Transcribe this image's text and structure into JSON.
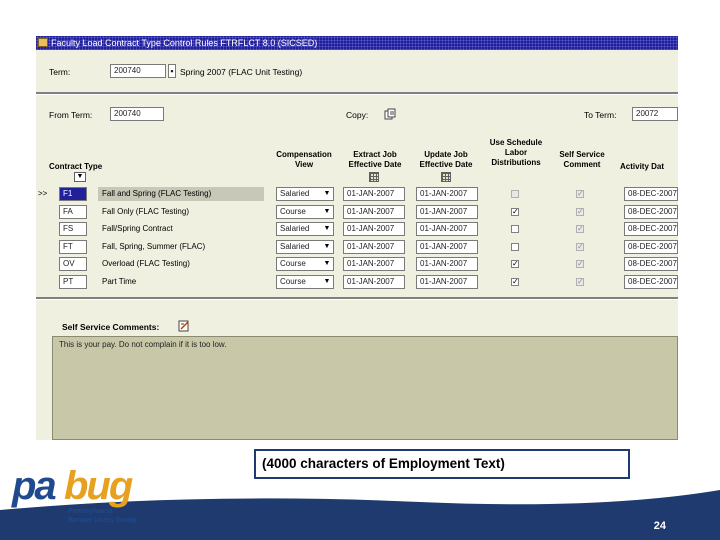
{
  "window": {
    "title": "Faculty Load Contract Type Control Rules  FTRFLCT  8.0  (SICSED)"
  },
  "header": {
    "term_label": "Term:",
    "term_value": "200740",
    "term_desc": "Spring 2007 (FLAC Unit Testing)"
  },
  "copy_section": {
    "from_label": "From Term:",
    "from_value": "200740",
    "copy_label": "Copy:",
    "to_label": "To Term:",
    "to_value": "20072"
  },
  "grid": {
    "headers": {
      "contract_type": "Contract Type",
      "compensation": "Compensation View",
      "extract_job": "Extract Job Effective Date",
      "update_job": "Update Job Effective Date",
      "use_schedule": "Use Schedule Labor Distributions",
      "self_service": "Self Service Comment",
      "activity_date": "Activity Dat"
    },
    "row_marker": ">>",
    "rows": [
      {
        "code": "F1",
        "desc": "Fall and Spring (FLAC Testing)",
        "comp": "Salaried",
        "extract": "01-JAN-2007",
        "update": "01-JAN-2007",
        "use_schedule": false,
        "self_service": true,
        "activity": "08-DEC-2007"
      },
      {
        "code": "FA",
        "desc": "Fall Only (FLAC Testing)",
        "comp": "Course",
        "extract": "01-JAN-2007",
        "update": "01-JAN-2007",
        "use_schedule": true,
        "self_service": true,
        "activity": "08-DEC-2007"
      },
      {
        "code": "FS",
        "desc": "Fall/Spring Contract",
        "comp": "Salaried",
        "extract": "01-JAN-2007",
        "update": "01-JAN-2007",
        "use_schedule": false,
        "self_service": true,
        "activity": "08-DEC-2007"
      },
      {
        "code": "FT",
        "desc": "Fall, Spring, Summer (FLAC)",
        "comp": "Salaried",
        "extract": "01-JAN-2007",
        "update": "01-JAN-2007",
        "use_schedule": false,
        "self_service": true,
        "activity": "08-DEC-2007"
      },
      {
        "code": "OV",
        "desc": "Overload (FLAC Testing)",
        "comp": "Course",
        "extract": "01-JAN-2007",
        "update": "01-JAN-2007",
        "use_schedule": true,
        "self_service": true,
        "activity": "08-DEC-2007"
      },
      {
        "code": "PT",
        "desc": "Part Time",
        "comp": "Course",
        "extract": "01-JAN-2007",
        "update": "01-JAN-2007",
        "use_schedule": true,
        "self_service": true,
        "activity": "08-DEC-2007"
      }
    ]
  },
  "comments": {
    "label": "Self Service Comments:",
    "text": "This is your pay.  Do not complain if it is too low."
  },
  "slide": {
    "note": "(4000 characters of Employment Text)",
    "page_number": "24",
    "logo_word_1": "pa",
    "logo_word_2": "bug",
    "logo_line_1": "Pennsylvania",
    "logo_line_2": "Banner Users Group",
    "colors": {
      "navy": "#1f3a6e",
      "logo_orange": "#e8a020",
      "logo_blue": "#1f4a8e"
    }
  },
  "icons": {
    "copy": "copy-icon",
    "calendar": "calendar-icon",
    "edit": "edit-note-icon",
    "dropdown": "chevron-down-icon"
  }
}
